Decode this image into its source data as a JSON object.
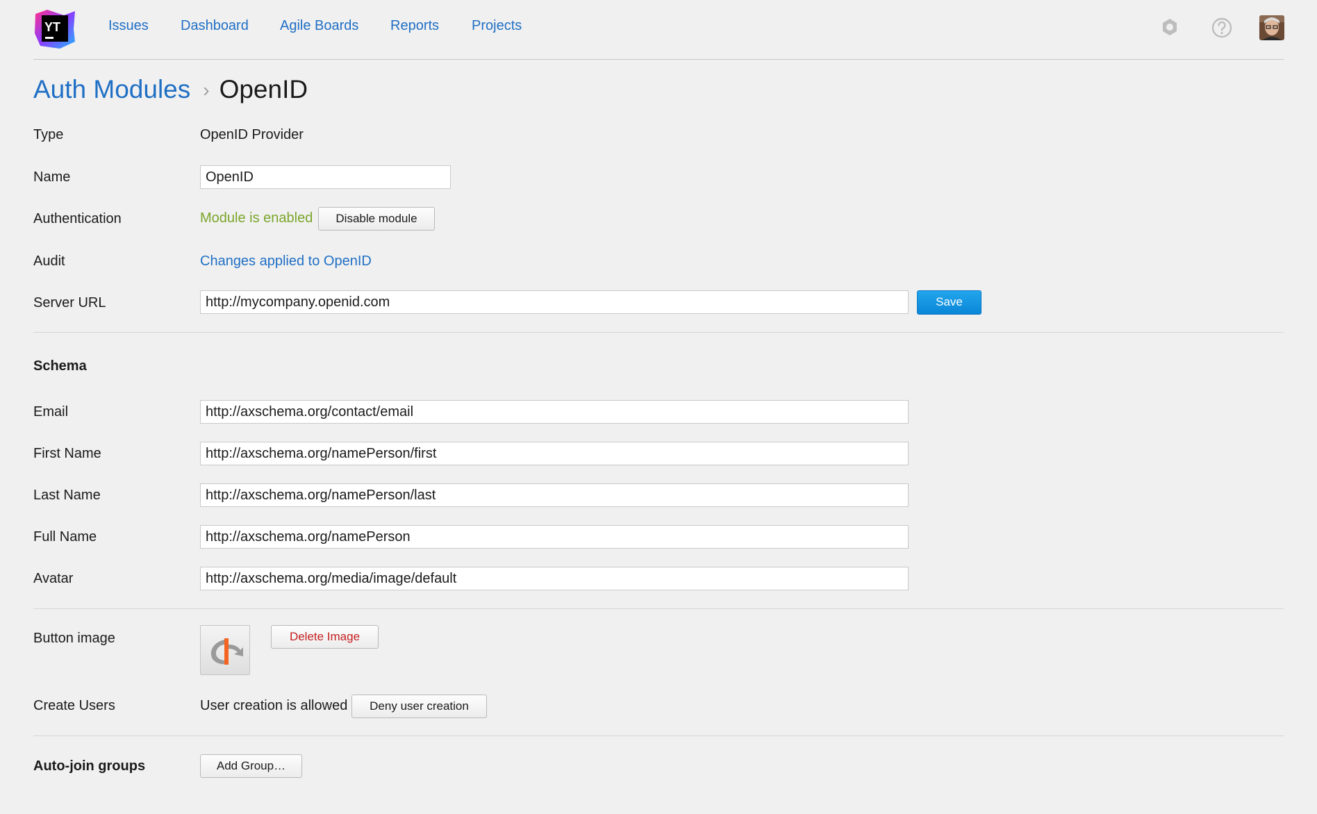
{
  "app": {
    "logo_text": "YT",
    "nav": [
      "Issues",
      "Dashboard",
      "Agile Boards",
      "Reports",
      "Projects"
    ],
    "icons": [
      "settings-icon",
      "help-icon",
      "avatar"
    ]
  },
  "breadcrumb": {
    "parent": "Auth Modules",
    "separator": "›",
    "current": "OpenID"
  },
  "fields": {
    "type": {
      "label": "Type",
      "value": "OpenID Provider"
    },
    "name": {
      "label": "Name",
      "value": "OpenID"
    },
    "authentication": {
      "label": "Authentication",
      "status": "Module is enabled",
      "button": "Disable module"
    },
    "audit": {
      "label": "Audit",
      "link": "Changes applied to OpenID"
    },
    "server_url": {
      "label": "Server URL",
      "value": "http://mycompany.openid.com",
      "button": "Save"
    }
  },
  "schema": {
    "heading": "Schema",
    "rows": [
      {
        "label": "Email",
        "value": "http://axschema.org/contact/email"
      },
      {
        "label": "First Name",
        "value": "http://axschema.org/namePerson/first"
      },
      {
        "label": "Last Name",
        "value": "http://axschema.org/namePerson/last"
      },
      {
        "label": "Full Name",
        "value": "http://axschema.org/namePerson"
      },
      {
        "label": "Avatar",
        "value": "http://axschema.org/media/image/default"
      }
    ]
  },
  "button_image": {
    "label": "Button image",
    "button": "Delete Image"
  },
  "create_users": {
    "label": "Create Users",
    "status": "User creation is allowed",
    "button": "Deny user creation"
  },
  "auto_join": {
    "label": "Auto-join groups",
    "button": "Add Group…"
  },
  "colors": {
    "link": "#1f6fc5",
    "enabled": "#7aa52a",
    "danger": "#c41e1e",
    "primary": "#0a87d8",
    "background": "#f0f0f0"
  }
}
